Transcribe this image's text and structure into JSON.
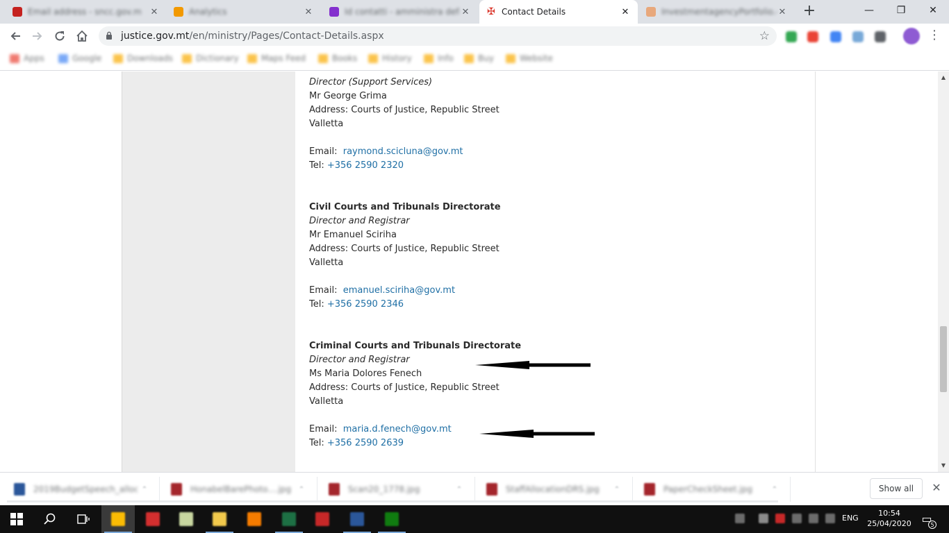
{
  "tabs": [
    {
      "title": "Email address - sncc.gov.m",
      "fav": "#c5221f"
    },
    {
      "title": "Analytics",
      "fav": "#f29900"
    },
    {
      "title": "Id contatti - amministra defa",
      "fav": "#8430ce"
    },
    {
      "title": "Contact Details",
      "fav": "#d93025"
    },
    {
      "title": "InvestmentagencyPortfolio.co.r",
      "fav": "#e8a87c"
    }
  ],
  "toolbar": {
    "url_host": "justice.gov.mt",
    "url_path": "/en/ministry/Pages/Contact-Details.aspx"
  },
  "bookmarks": [
    "Apps",
    "Google",
    "Downloads",
    "Dictionary",
    "Maps Feed",
    "Books",
    "History",
    "Info",
    "Buy",
    "Website"
  ],
  "contacts": {
    "top": {
      "role": "Director (Support Services)",
      "name": "Mr George Grima",
      "address": "Address: Courts of Justice, Republic Street",
      "city": "Valletta",
      "email_label": "Email:",
      "email": "raymond.scicluna@gov.mt",
      "tel_label": "Tel:",
      "tel": "+356 2590 2320"
    },
    "civil": {
      "heading": "Civil Courts and Tribunals Directorate",
      "role": "Director and Registrar",
      "name": "Mr Emanuel Sciriha",
      "address": "Address: Courts of Justice, Republic Street",
      "city": "Valletta",
      "email_label": "Email:",
      "email": "emanuel.sciriha@gov.mt",
      "tel_label": "Tel:",
      "tel": "+356 2590 2346"
    },
    "criminal": {
      "heading": "Criminal Courts and Tribunals Directorate",
      "role": "Director and Registrar",
      "name": "Ms Maria Dolores Fenech",
      "address": "Address: Courts of Justice, Republic Street",
      "city": "Valletta",
      "email_label": "Email:",
      "email": "maria.d.fenech@gov.mt",
      "tel_label": "Tel:",
      "tel": "+356 2590 2639"
    }
  },
  "downloads": [
    {
      "name": "2019BudgetSpeech_allocs.docx",
      "color": "#2b579a"
    },
    {
      "name": "HonabelBarePhoto....jpg",
      "color": "#a4262c"
    },
    {
      "name": "Scan20_1778.jpg",
      "color": "#a4262c"
    },
    {
      "name": "StaffAllocationDRS.jpg",
      "color": "#a4262c"
    },
    {
      "name": "PaperCheckSheet.jpg",
      "color": "#a4262c"
    }
  ],
  "shelf": {
    "show_all": "Show all"
  },
  "taskbar": {
    "lang": "ENG",
    "time": "10:54",
    "date": "25/04/2020",
    "notifications": "5"
  }
}
